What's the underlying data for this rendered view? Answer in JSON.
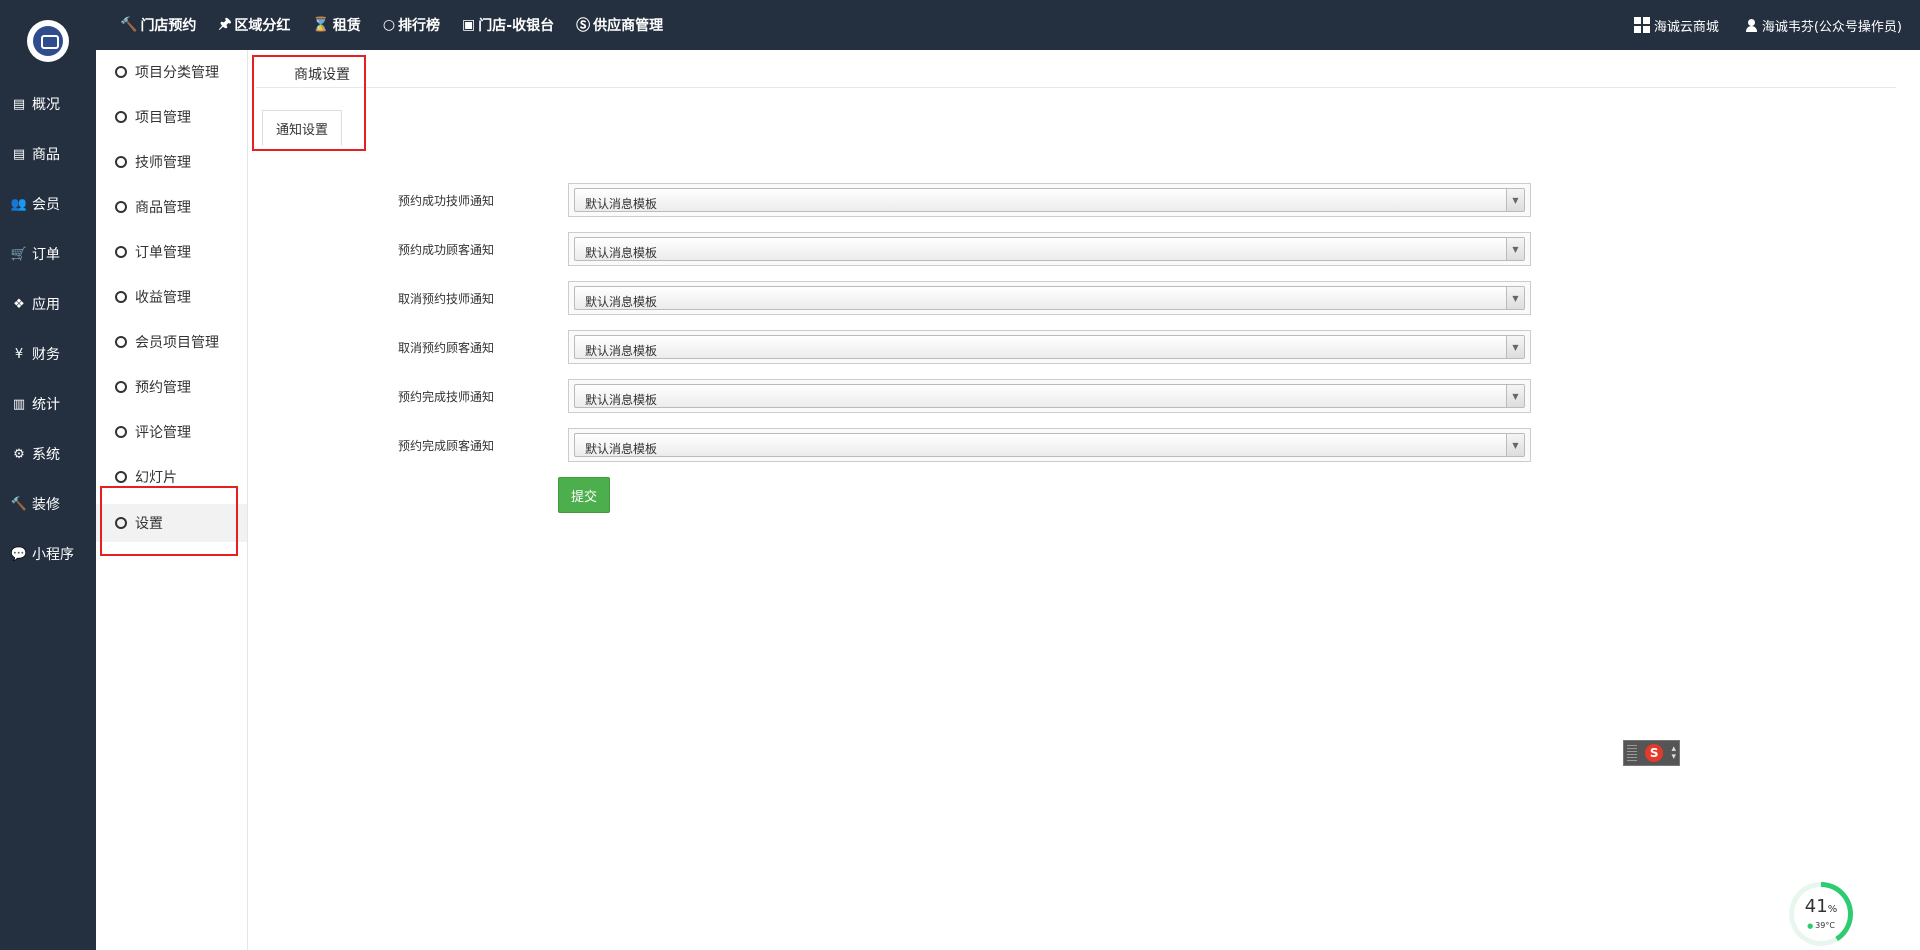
{
  "left_nav": {
    "items": [
      {
        "icon": "inbox-icon",
        "glyph": "▤",
        "label": "概况"
      },
      {
        "icon": "box-icon",
        "glyph": "▤",
        "label": "商品"
      },
      {
        "icon": "users-icon",
        "glyph": "👥",
        "label": "会员"
      },
      {
        "icon": "cart-icon",
        "glyph": "🛒",
        "label": "订单"
      },
      {
        "icon": "apps-icon",
        "glyph": "❖",
        "label": "应用"
      },
      {
        "icon": "yen-icon",
        "glyph": "¥",
        "label": "财务"
      },
      {
        "icon": "bar-chart-icon",
        "glyph": "▥",
        "label": "统计"
      },
      {
        "icon": "cogs-icon",
        "glyph": "⚙",
        "label": "系统"
      },
      {
        "icon": "gavel-icon",
        "glyph": "🔨",
        "label": "装修"
      },
      {
        "icon": "wechat-icon",
        "glyph": "💬",
        "label": "小程序"
      }
    ]
  },
  "top_menu": [
    {
      "icon": "gavel-icon",
      "glyph": "🔨",
      "label": "门店预约"
    },
    {
      "icon": "pin-icon",
      "glyph": "🖈",
      "label": "区域分红"
    },
    {
      "icon": "hourglass-icon",
      "glyph": "⌛",
      "label": "租赁"
    },
    {
      "icon": "circle-icon",
      "glyph": "○",
      "label": "排行榜"
    },
    {
      "icon": "cash-icon",
      "glyph": "▣",
      "label": "门店-收银台"
    },
    {
      "icon": "skype-icon",
      "glyph": "Ⓢ",
      "label": "供应商管理"
    }
  ],
  "top_right": {
    "store_label": "海诚云商城",
    "user_label": "海诚韦芬(公众号操作员)"
  },
  "sub_nav": {
    "items": [
      "项目分类管理",
      "项目管理",
      "技师管理",
      "商品管理",
      "订单管理",
      "收益管理",
      "会员项目管理",
      "预约管理",
      "评论管理",
      "幻灯片",
      "设置"
    ],
    "active_index": 10
  },
  "main": {
    "breadcrumb": "商城设置",
    "tab": "通知设置",
    "fields": [
      {
        "label": "预约成功技师通知",
        "value": "默认消息模板"
      },
      {
        "label": "预约成功顾客通知",
        "value": "默认消息模板"
      },
      {
        "label": "取消预约技师通知",
        "value": "默认消息模板"
      },
      {
        "label": "取消预约顾客通知",
        "value": "默认消息模板"
      },
      {
        "label": "预约完成技师通知",
        "value": "默认消息模板"
      },
      {
        "label": "预约完成顾客通知",
        "value": "默认消息模板"
      }
    ],
    "submit_label": "提交"
  },
  "widgets": {
    "ime_logo": "S",
    "perf_percent": "41",
    "perf_percent_unit": "%",
    "perf_temp": "39°C"
  },
  "colors": {
    "nav_bg": "#243040",
    "submit_green": "#4cae4c",
    "annotation_red": "#e62020"
  }
}
